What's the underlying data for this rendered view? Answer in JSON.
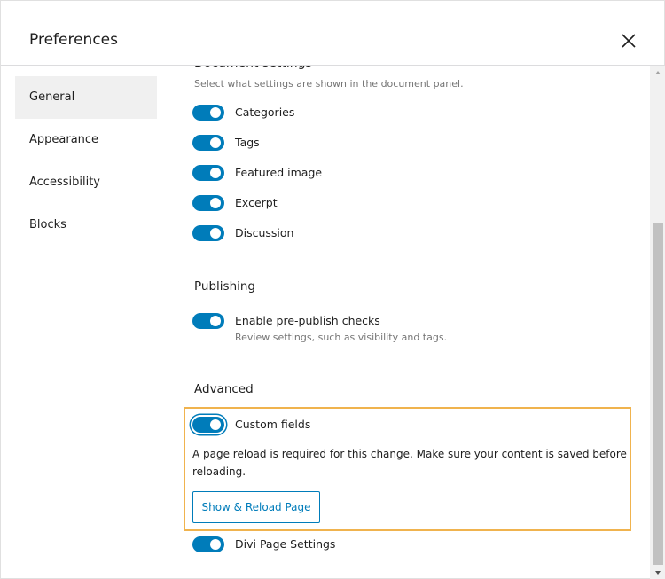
{
  "modal": {
    "title": "Preferences",
    "close_icon": "close-icon"
  },
  "sidebar": {
    "tabs": [
      {
        "label": "General",
        "active": true
      },
      {
        "label": "Appearance",
        "active": false
      },
      {
        "label": "Accessibility",
        "active": false
      },
      {
        "label": "Blocks",
        "active": false
      }
    ]
  },
  "document_settings": {
    "description": "Select what settings are shown in the document panel.",
    "toggles": [
      {
        "label": "Categories",
        "checked": true
      },
      {
        "label": "Tags",
        "checked": true
      },
      {
        "label": "Featured image",
        "checked": true
      },
      {
        "label": "Excerpt",
        "checked": true
      },
      {
        "label": "Discussion",
        "checked": true
      }
    ]
  },
  "publishing": {
    "title": "Publishing",
    "toggle_label": "Enable pre-publish checks",
    "toggle_help": "Review settings, such as visibility and tags.",
    "checked": true
  },
  "advanced": {
    "title": "Advanced",
    "custom_fields_label": "Custom fields",
    "custom_fields_checked": true,
    "notice": "A page reload is required for this change. Make sure your content is saved before reloading.",
    "reload_button": "Show & Reload Page",
    "divi_label": "Divi Page Settings",
    "divi_checked": true
  },
  "colors": {
    "accent": "#007cba",
    "highlight_border": "#f0b34e",
    "help_text": "#757575"
  }
}
